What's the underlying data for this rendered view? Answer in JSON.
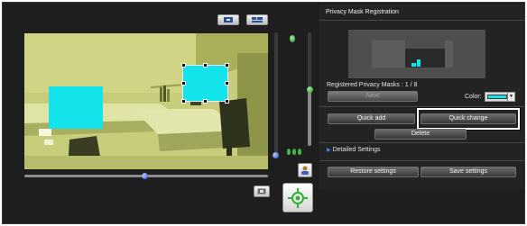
{
  "panel": {
    "title": "Privacy Mask Registration",
    "registered_label": "Registered Privacy Masks : 1 / 8",
    "next_label": "Next",
    "color_label": "Color:",
    "selected_color": "#13e3ea",
    "quick_add_label": "Quick add",
    "quick_change_label": "Quick change",
    "delete_label": "Delete",
    "detailed_settings_label": "Detailed Settings",
    "restore_label": "Restore settings",
    "save_label": "Save settings"
  },
  "camera": {
    "mask_color": "#13e3ea"
  },
  "icons": {
    "view_mode_1": "single-view-icon",
    "view_mode_2": "multi-view-icon",
    "crop": "crop-icon",
    "zoom": "person-zoom-icon",
    "joystick": "pan-tilt-joystick-icon",
    "focus": "focus-icon"
  }
}
